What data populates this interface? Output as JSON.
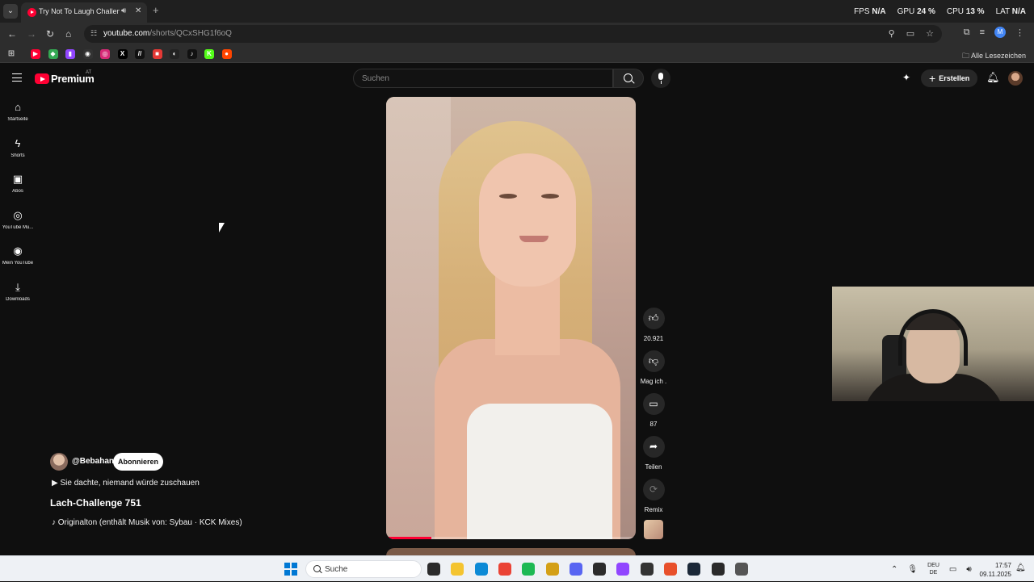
{
  "browser": {
    "tab_title": "Try Not To Laugh Challenge",
    "sound_icon": "speaker-icon",
    "close_glyph": "✕",
    "new_tab_glyph": "+",
    "url_host": "youtube.com",
    "url_path": "/shorts/QCxSHG1f6oQ",
    "all_bookmarks": "Alle Lesezeichen",
    "profile_initial": "M"
  },
  "perf_overlay": [
    {
      "label": "FPS",
      "value": "N/A"
    },
    {
      "label": "GPU",
      "value": "24 %"
    },
    {
      "label": "CPU",
      "value": "13 %"
    },
    {
      "label": "LAT",
      "value": "N/A"
    }
  ],
  "bookmarks": [
    {
      "icon": "youtube-icon",
      "color": "#ff0033",
      "glyph": "▶"
    },
    {
      "icon": "colorful-icon",
      "color": "#34a853",
      "glyph": "◆"
    },
    {
      "icon": "twitch-icon",
      "color": "#9146ff",
      "glyph": "▮"
    },
    {
      "icon": "dark-app-icon",
      "color": "#333333",
      "glyph": "◉"
    },
    {
      "icon": "instagram-icon",
      "color": "#d62976",
      "glyph": "◎"
    },
    {
      "icon": "x-icon",
      "color": "#000000",
      "glyph": "X"
    },
    {
      "icon": "slash-icon",
      "color": "#111111",
      "glyph": "//"
    },
    {
      "icon": "red-app-icon",
      "color": "#e53935",
      "glyph": "■"
    },
    {
      "icon": "circle-app-icon",
      "color": "#222222",
      "glyph": "◐"
    },
    {
      "icon": "tiktok-icon",
      "color": "#111111",
      "glyph": "♪"
    },
    {
      "icon": "kick-icon",
      "color": "#53fc18",
      "glyph": "K"
    },
    {
      "icon": "reddit-icon",
      "color": "#ff4500",
      "glyph": "●"
    }
  ],
  "youtube": {
    "brand": "Premium",
    "region": "AT",
    "search_placeholder": "Suchen",
    "create_label": "Erstellen"
  },
  "sidebar": {
    "items": [
      {
        "label": "Startseite",
        "icon": "home-icon",
        "glyph": "⌂"
      },
      {
        "label": "Shorts",
        "icon": "shorts-icon",
        "glyph": "ϟ"
      },
      {
        "label": "Abos",
        "icon": "subscriptions-icon",
        "glyph": "▣"
      },
      {
        "label": "YouTube Mu...",
        "icon": "music-icon",
        "glyph": "◎"
      },
      {
        "label": "Mein YouTube",
        "icon": "user-icon",
        "glyph": "◉"
      },
      {
        "label": "Downloads",
        "icon": "download-icon",
        "glyph": "⤓"
      }
    ]
  },
  "short": {
    "progress": 0.18,
    "actions": [
      {
        "name": "like",
        "icon": "thumbs-up-icon",
        "glyph": "👍︎",
        "label": "20.921"
      },
      {
        "name": "dislike",
        "icon": "thumbs-down-icon",
        "glyph": "👎︎",
        "label": "Mag ich ."
      },
      {
        "name": "comments",
        "icon": "comment-icon",
        "glyph": "▭",
        "label": "87"
      },
      {
        "name": "share",
        "icon": "share-icon",
        "glyph": "➦",
        "label": "Teilen"
      },
      {
        "name": "remix",
        "icon": "remix-icon",
        "glyph": "⟳",
        "label": "Remix"
      }
    ],
    "channel": "@Bebahan",
    "subscribe_label": "Abonnieren",
    "description": "▶ Sie dachte, niemand würde zuschauen",
    "title": "Lach-Challenge 751",
    "sound": "♪ Originalton (enthält Musik von: Sybau · KCK Mixes)"
  },
  "taskbar": {
    "search_label": "Suche",
    "apps": [
      {
        "icon": "file-explorer-dark-icon",
        "color": "#2b2b2b"
      },
      {
        "icon": "folder-icon",
        "color": "#f4c430"
      },
      {
        "icon": "edge-icon",
        "color": "#0c8ad6"
      },
      {
        "icon": "chrome-icon",
        "color": "#ea4335"
      },
      {
        "icon": "spotify-icon",
        "color": "#1db954"
      },
      {
        "icon": "app-yellow-icon",
        "color": "#d4a017"
      },
      {
        "icon": "discord-icon",
        "color": "#5865f2"
      },
      {
        "icon": "obs-icon",
        "color": "#2b2b2b"
      },
      {
        "icon": "twitch-icon",
        "color": "#9146ff"
      },
      {
        "icon": "shield-app-icon",
        "color": "#333333"
      },
      {
        "icon": "game-launcher-icon",
        "color": "#e8502b"
      },
      {
        "icon": "steam-icon",
        "color": "#1b2838"
      },
      {
        "icon": "epic-games-icon",
        "color": "#2a2a2a"
      },
      {
        "icon": "ring-app-icon",
        "color": "#555555"
      }
    ],
    "lang_top": "DEU",
    "lang_bottom": "DE",
    "time": "17:57",
    "date": "09.11.2025"
  }
}
